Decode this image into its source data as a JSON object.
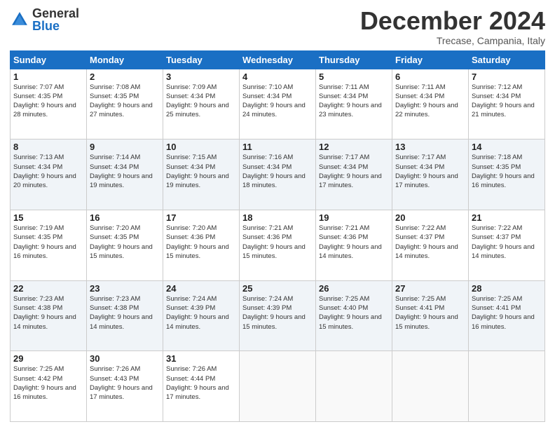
{
  "logo": {
    "general": "General",
    "blue": "Blue"
  },
  "header": {
    "month_title": "December 2024",
    "location": "Trecase, Campania, Italy"
  },
  "weekdays": [
    "Sunday",
    "Monday",
    "Tuesday",
    "Wednesday",
    "Thursday",
    "Friday",
    "Saturday"
  ],
  "weeks": [
    [
      {
        "day": "1",
        "sunrise": "7:07 AM",
        "sunset": "4:35 PM",
        "daylight": "9 hours and 28 minutes."
      },
      {
        "day": "2",
        "sunrise": "7:08 AM",
        "sunset": "4:35 PM",
        "daylight": "9 hours and 27 minutes."
      },
      {
        "day": "3",
        "sunrise": "7:09 AM",
        "sunset": "4:34 PM",
        "daylight": "9 hours and 25 minutes."
      },
      {
        "day": "4",
        "sunrise": "7:10 AM",
        "sunset": "4:34 PM",
        "daylight": "9 hours and 24 minutes."
      },
      {
        "day": "5",
        "sunrise": "7:11 AM",
        "sunset": "4:34 PM",
        "daylight": "9 hours and 23 minutes."
      },
      {
        "day": "6",
        "sunrise": "7:11 AM",
        "sunset": "4:34 PM",
        "daylight": "9 hours and 22 minutes."
      },
      {
        "day": "7",
        "sunrise": "7:12 AM",
        "sunset": "4:34 PM",
        "daylight": "9 hours and 21 minutes."
      }
    ],
    [
      {
        "day": "8",
        "sunrise": "7:13 AM",
        "sunset": "4:34 PM",
        "daylight": "9 hours and 20 minutes."
      },
      {
        "day": "9",
        "sunrise": "7:14 AM",
        "sunset": "4:34 PM",
        "daylight": "9 hours and 19 minutes."
      },
      {
        "day": "10",
        "sunrise": "7:15 AM",
        "sunset": "4:34 PM",
        "daylight": "9 hours and 19 minutes."
      },
      {
        "day": "11",
        "sunrise": "7:16 AM",
        "sunset": "4:34 PM",
        "daylight": "9 hours and 18 minutes."
      },
      {
        "day": "12",
        "sunrise": "7:17 AM",
        "sunset": "4:34 PM",
        "daylight": "9 hours and 17 minutes."
      },
      {
        "day": "13",
        "sunrise": "7:17 AM",
        "sunset": "4:34 PM",
        "daylight": "9 hours and 17 minutes."
      },
      {
        "day": "14",
        "sunrise": "7:18 AM",
        "sunset": "4:35 PM",
        "daylight": "9 hours and 16 minutes."
      }
    ],
    [
      {
        "day": "15",
        "sunrise": "7:19 AM",
        "sunset": "4:35 PM",
        "daylight": "9 hours and 16 minutes."
      },
      {
        "day": "16",
        "sunrise": "7:20 AM",
        "sunset": "4:35 PM",
        "daylight": "9 hours and 15 minutes."
      },
      {
        "day": "17",
        "sunrise": "7:20 AM",
        "sunset": "4:36 PM",
        "daylight": "9 hours and 15 minutes."
      },
      {
        "day": "18",
        "sunrise": "7:21 AM",
        "sunset": "4:36 PM",
        "daylight": "9 hours and 15 minutes."
      },
      {
        "day": "19",
        "sunrise": "7:21 AM",
        "sunset": "4:36 PM",
        "daylight": "9 hours and 14 minutes."
      },
      {
        "day": "20",
        "sunrise": "7:22 AM",
        "sunset": "4:37 PM",
        "daylight": "9 hours and 14 minutes."
      },
      {
        "day": "21",
        "sunrise": "7:22 AM",
        "sunset": "4:37 PM",
        "daylight": "9 hours and 14 minutes."
      }
    ],
    [
      {
        "day": "22",
        "sunrise": "7:23 AM",
        "sunset": "4:38 PM",
        "daylight": "9 hours and 14 minutes."
      },
      {
        "day": "23",
        "sunrise": "7:23 AM",
        "sunset": "4:38 PM",
        "daylight": "9 hours and 14 minutes."
      },
      {
        "day": "24",
        "sunrise": "7:24 AM",
        "sunset": "4:39 PM",
        "daylight": "9 hours and 14 minutes."
      },
      {
        "day": "25",
        "sunrise": "7:24 AM",
        "sunset": "4:39 PM",
        "daylight": "9 hours and 15 minutes."
      },
      {
        "day": "26",
        "sunrise": "7:25 AM",
        "sunset": "4:40 PM",
        "daylight": "9 hours and 15 minutes."
      },
      {
        "day": "27",
        "sunrise": "7:25 AM",
        "sunset": "4:41 PM",
        "daylight": "9 hours and 15 minutes."
      },
      {
        "day": "28",
        "sunrise": "7:25 AM",
        "sunset": "4:41 PM",
        "daylight": "9 hours and 16 minutes."
      }
    ],
    [
      {
        "day": "29",
        "sunrise": "7:25 AM",
        "sunset": "4:42 PM",
        "daylight": "9 hours and 16 minutes."
      },
      {
        "day": "30",
        "sunrise": "7:26 AM",
        "sunset": "4:43 PM",
        "daylight": "9 hours and 17 minutes."
      },
      {
        "day": "31",
        "sunrise": "7:26 AM",
        "sunset": "4:44 PM",
        "daylight": "9 hours and 17 minutes."
      },
      null,
      null,
      null,
      null
    ]
  ],
  "labels": {
    "sunrise": "Sunrise:",
    "sunset": "Sunset:",
    "daylight": "Daylight:"
  }
}
